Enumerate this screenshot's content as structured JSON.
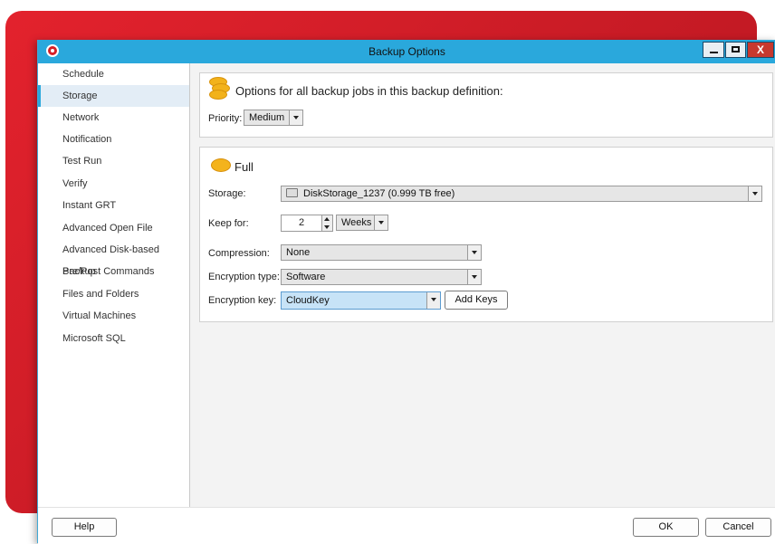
{
  "window": {
    "title": "Backup Options",
    "close_label": "X"
  },
  "sidebar": {
    "items": [
      {
        "label": "Schedule"
      },
      {
        "label": "Storage"
      },
      {
        "label": "Network"
      },
      {
        "label": "Notification"
      },
      {
        "label": "Test Run"
      },
      {
        "label": "Verify"
      },
      {
        "label": "Instant GRT"
      },
      {
        "label": "Advanced Open File"
      },
      {
        "label": "Advanced Disk-based Backup"
      },
      {
        "label": "Pre/Post Commands"
      },
      {
        "label": "Files and Folders"
      },
      {
        "label": "Virtual Machines"
      },
      {
        "label": "Microsoft SQL"
      }
    ],
    "selected": "Storage"
  },
  "general_panel": {
    "heading": "Options for all backup jobs in this backup definition:",
    "priority_label": "Priority:",
    "priority_value": "Medium"
  },
  "full_panel": {
    "heading": "Full",
    "storage_label": "Storage:",
    "storage_value": "DiskStorage_1237 (0.999 TB free)",
    "keep_label": "Keep for:",
    "keep_value": "2",
    "keep_unit": "Weeks",
    "compression_label": "Compression:",
    "compression_value": "None",
    "encryption_type_label": "Encryption type:",
    "encryption_type_value": "Software",
    "encryption_key_label": "Encryption key:",
    "encryption_key_value": "CloudKey",
    "add_keys_label": "Add Keys"
  },
  "footer": {
    "help_label": "Help",
    "ok_label": "OK",
    "cancel_label": "Cancel"
  },
  "colors": {
    "accent": "#2aa8dc",
    "brand_red": "#d61f26",
    "selected_field": "#c7e3f7"
  }
}
